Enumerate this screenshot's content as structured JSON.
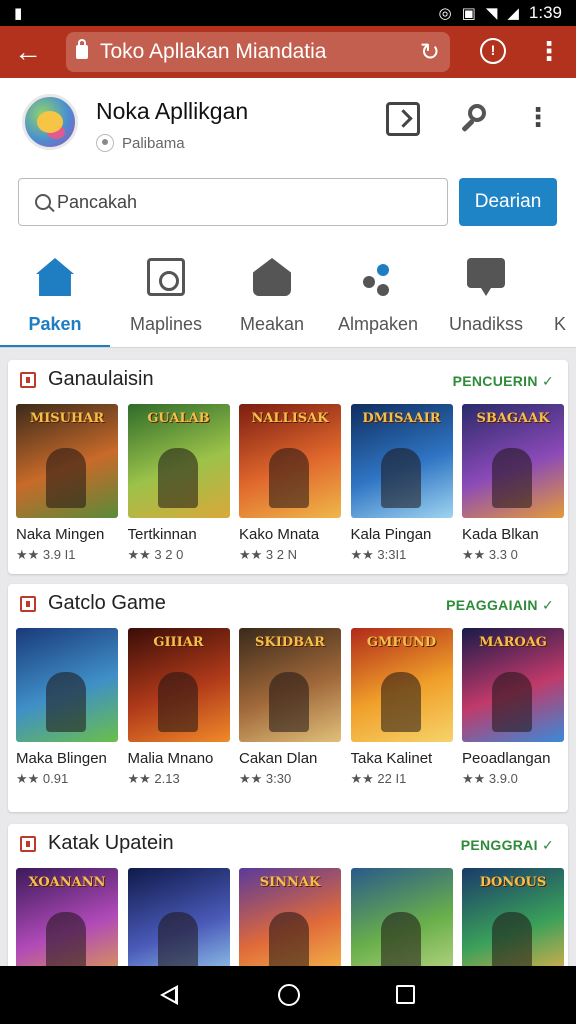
{
  "status_bar": {
    "time": "1:39",
    "left_icon": "notification-icon"
  },
  "browser": {
    "url": "Toko Apllakan Miandatia",
    "back": "←",
    "reload": "↻",
    "info": "!",
    "menu": "⋮"
  },
  "app": {
    "name": "Noka Apllikgan",
    "subtitle": "Palibama"
  },
  "search": {
    "placeholder": "Pancakah",
    "button": "Dearian"
  },
  "tabs": [
    {
      "label": "Paken",
      "icon": "home-icon",
      "active": true
    },
    {
      "label": "Maplines",
      "icon": "box-icon"
    },
    {
      "label": "Meakan",
      "icon": "house-icon"
    },
    {
      "label": "Almpaken",
      "icon": "share-icon"
    },
    {
      "label": "Unadikss",
      "icon": "chat-icon"
    },
    {
      "label": "K",
      "icon": "more-icon"
    }
  ],
  "sections": [
    {
      "title": "Ganaulaisin",
      "more": "PENCUERIN ✓",
      "items": [
        {
          "name": "Naka Mingen",
          "rating": "★★ 3.9 I1",
          "thumb_title": "MISUHAR",
          "colors": [
            "#3b2a1a",
            "#c86a2a",
            "#5a8a3a"
          ]
        },
        {
          "name": "Tertkinnan",
          "rating": "★★ 3 2 0",
          "thumb_title": "GUALAB",
          "colors": [
            "#2f6b2a",
            "#9bc24a",
            "#d9a83a"
          ]
        },
        {
          "name": "Kako Mnata",
          "rating": "★★ 3 2 N",
          "thumb_title": "NALLISAK",
          "colors": [
            "#7a1d12",
            "#e0672c",
            "#f0b74a"
          ]
        },
        {
          "name": "Kala Pingan",
          "rating": "★★ 3:3I1",
          "thumb_title": "DMISAAIR",
          "colors": [
            "#0f2e5e",
            "#2f75c4",
            "#9fd3f0"
          ]
        },
        {
          "name": "Kada Blkan",
          "rating": "★★ 3.3 0",
          "thumb_title": "SBAGAAK",
          "colors": [
            "#2a2a6a",
            "#8a4ab8",
            "#e49a3a"
          ]
        }
      ]
    },
    {
      "title": "Gatclo Game",
      "more": "PEAGGAIAIN ✓",
      "items": [
        {
          "name": "Maka Blingen",
          "rating": "★★ 0.91",
          "thumb_title": "",
          "colors": [
            "#1a3a7a",
            "#3f8fc8",
            "#6abf4a"
          ]
        },
        {
          "name": "Malia Mnano",
          "rating": "★★ 2.13",
          "thumb_title": "GIIIAR",
          "colors": [
            "#3a0d08",
            "#b03a1a",
            "#f08a2a"
          ]
        },
        {
          "name": "Cakan Dlan",
          "rating": "★★ 3:30",
          "thumb_title": "SKIDBAR",
          "colors": [
            "#3a2a1a",
            "#a0683a",
            "#e0c07a"
          ]
        },
        {
          "name": "Taka Kalinet",
          "rating": "★★ 22 I1",
          "thumb_title": "GMFUND",
          "colors": [
            "#b02a1a",
            "#f0a02a",
            "#f6d36a"
          ]
        },
        {
          "name": "Peoadlangan",
          "rating": "★★ 3.9.0",
          "thumb_title": "MAROAG",
          "colors": [
            "#1a1a4a",
            "#c03a6a",
            "#3a8ad8"
          ]
        }
      ]
    },
    {
      "title": "Katak  Upatein",
      "more": "PENGGRAI ✓",
      "items": [
        {
          "name": "",
          "rating": "",
          "thumb_title": "XOANANN",
          "colors": [
            "#3a1a5a",
            "#b04ab8",
            "#e0a04a"
          ]
        },
        {
          "name": "",
          "rating": "",
          "thumb_title": "",
          "colors": [
            "#0f1a4a",
            "#4a5ab8",
            "#9ad0f0"
          ]
        },
        {
          "name": "",
          "rating": "",
          "thumb_title": "SINNAK",
          "colors": [
            "#5a3a9a",
            "#e06a3a",
            "#f6c04a"
          ]
        },
        {
          "name": "",
          "rating": "",
          "thumb_title": "",
          "colors": [
            "#2a5a8a",
            "#6ab04a",
            "#c0d88a"
          ]
        },
        {
          "name": "",
          "rating": "",
          "thumb_title": "DONOUS",
          "colors": [
            "#1a3a6a",
            "#3aa05a",
            "#f0b04a"
          ]
        }
      ]
    }
  ],
  "nav": {
    "back": "back-icon",
    "home": "home-icon",
    "recent": "recents-icon"
  }
}
